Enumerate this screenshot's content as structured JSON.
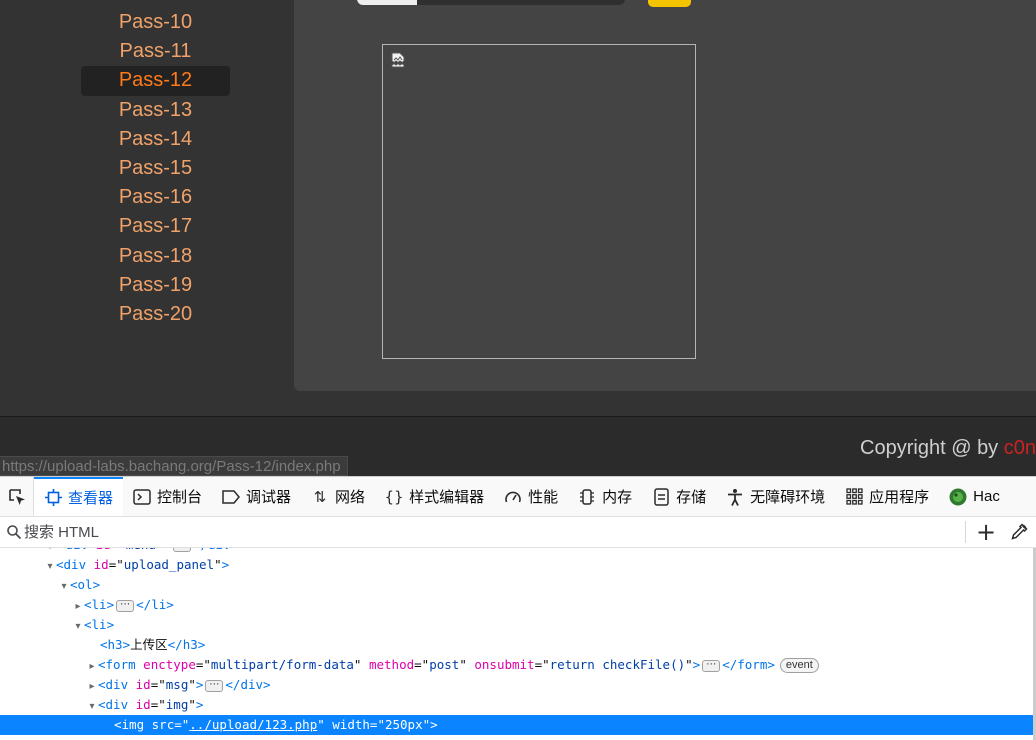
{
  "menu": {
    "items": [
      "Pass-10",
      "Pass-11",
      "Pass-12",
      "Pass-13",
      "Pass-14",
      "Pass-15",
      "Pass-16",
      "Pass-17",
      "Pass-18",
      "Pass-19",
      "Pass-20"
    ],
    "active": "Pass-12"
  },
  "footer": {
    "copyright": "Copyright @ ",
    "by": " by ",
    "author": "c0n"
  },
  "status_url": "https://upload-labs.bachang.org/Pass-12/index.php",
  "devtools": {
    "tabs": [
      {
        "label": "查看器",
        "icon": "inspector-icon"
      },
      {
        "label": "控制台",
        "icon": "console-icon"
      },
      {
        "label": "调试器",
        "icon": "debugger-icon"
      },
      {
        "label": "网络",
        "icon": "network-icon"
      },
      {
        "label": "样式编辑器",
        "icon": "style-editor-icon"
      },
      {
        "label": "性能",
        "icon": "performance-icon"
      },
      {
        "label": "内存",
        "icon": "memory-icon"
      },
      {
        "label": "存储",
        "icon": "storage-icon"
      },
      {
        "label": "无障碍环境",
        "icon": "accessibility-icon"
      },
      {
        "label": "应用程序",
        "icon": "application-icon"
      },
      {
        "label": "Hac",
        "icon": "hackbar-icon"
      }
    ],
    "selected_tab": "查看器",
    "search_placeholder": "搜索 HTML",
    "tree": {
      "r0": {
        "tag": "div",
        "attr": "id",
        "val": "menu",
        "close": "div"
      },
      "r1": {
        "tag": "div",
        "attr": "id",
        "val": "upload_panel"
      },
      "r2": {
        "tag": "ol"
      },
      "r3": {
        "tag": "li",
        "close": "li"
      },
      "r4": {
        "tag": "li"
      },
      "r5": {
        "tag": "h3",
        "text": "上传区",
        "close": "h3"
      },
      "r6": {
        "tag": "form",
        "a1": "enctype",
        "v1": "multipart/form-data",
        "a2": "method",
        "v2": "post",
        "a3": "onsubmit",
        "v3": "return checkFile()",
        "close": "form",
        "badge": "event"
      },
      "r7": {
        "tag": "div",
        "attr": "id",
        "val": "msg",
        "close": "div"
      },
      "r8": {
        "tag": "div",
        "attr": "id",
        "val": "img"
      },
      "r9": {
        "tag": "img",
        "a1": "src",
        "v1": "../upload/123.php",
        "a2": "width",
        "v2": "250px"
      }
    }
  },
  "colors": {
    "menu_text": "#f0a26a",
    "menu_active": "#ff7a1a",
    "selection": "#0a84ff",
    "upload_button": "#f5c400"
  }
}
